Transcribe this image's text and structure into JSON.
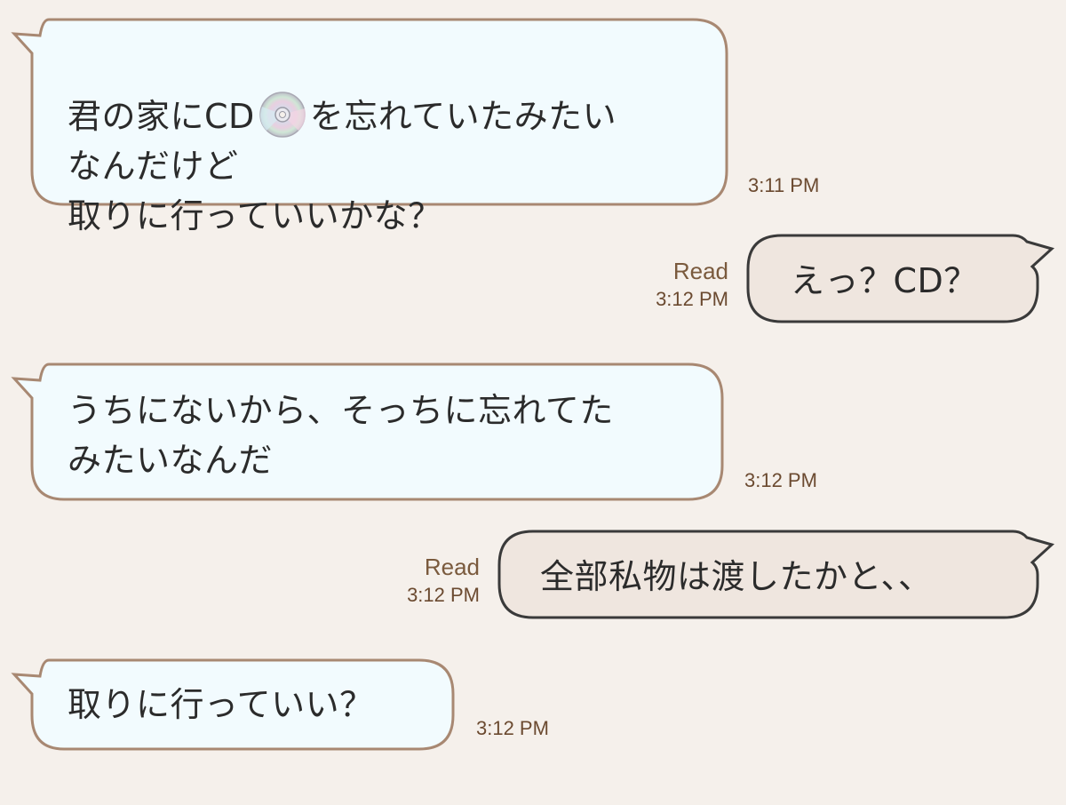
{
  "messages": [
    {
      "side": "incoming",
      "text_before_icon": "君の家にCD",
      "icon": "cd-disc-icon",
      "text_after_icon": "を忘れていたみたい\nなんだけど\n取りに行っていいかな？",
      "time": "3:11 PM"
    },
    {
      "side": "outgoing",
      "text": "えっ？CD？",
      "read": "Read",
      "time": "3:12 PM"
    },
    {
      "side": "incoming",
      "text": "うちにないから、そっちに忘れてた\nみたいなんだ",
      "time": "3:12 PM"
    },
    {
      "side": "outgoing",
      "text": "全部私物は渡したかと、、",
      "read": "Read",
      "time": "3:12 PM"
    },
    {
      "side": "incoming",
      "text": "取りに行っていい？",
      "time": "3:12 PM"
    }
  ],
  "colors": {
    "background": "#f5f0eb",
    "incoming_bubble": "#f2fbfe",
    "incoming_border": "#a88872",
    "outgoing_bubble": "#efe6df",
    "outgoing_border": "#3a3a3a",
    "meta_text": "#7a5a3d"
  }
}
